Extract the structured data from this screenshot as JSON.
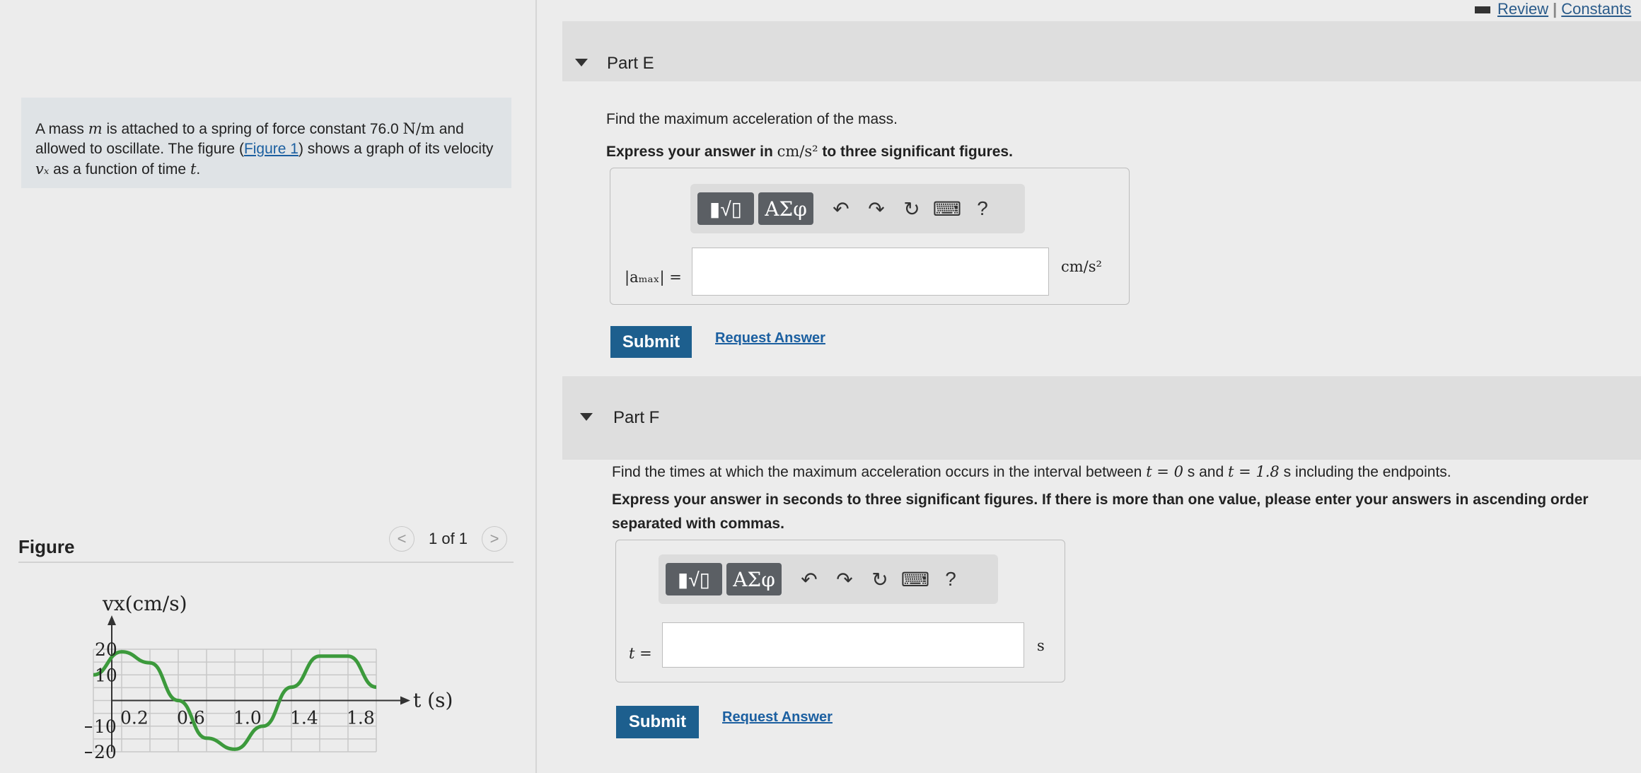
{
  "topbar": {
    "review": "Review",
    "constants": "Constants",
    "separator": "|"
  },
  "intro": {
    "p1": "A mass ",
    "m": "m",
    "p2": " is attached to a spring of force constant 76.0 ",
    "unit": "N/m",
    "p3": " and allowed to oscillate. The figure (",
    "link": "Figure 1",
    "p4": ") shows a graph of its velocity ",
    "vx": "vₓ",
    "p5": " as a function of time ",
    "t": "t",
    "p6": "."
  },
  "figure": {
    "title": "Figure",
    "pager": "1 of 1",
    "prev": "<",
    "next": ">",
    "chart_data": {
      "type": "line",
      "ylabel": "vx(cm/s)",
      "xlabel": "t (s)",
      "xticks": [
        "0.2",
        "0.6",
        "1.0",
        "1.4",
        "1.8"
      ],
      "yticks": [
        "20",
        "10",
        "−10",
        "−20"
      ],
      "xlim": [
        0,
        2.0
      ],
      "ylim": [
        -20,
        20
      ],
      "series": [
        {
          "x": [
            0,
            0.2,
            0.4,
            0.6,
            0.8,
            1.0,
            1.2,
            1.4,
            1.6,
            1.8,
            2.0
          ],
          "values": [
            10,
            19.0,
            14.7,
            0,
            -14.7,
            -19.0,
            -10,
            5.2,
            17.3,
            17.3,
            5.2
          ]
        }
      ]
    }
  },
  "partE": {
    "label": "Part E",
    "question": "Find the maximum acceleration of the mass.",
    "instr1": "Express your answer in ",
    "instr_unit": "cm/s²",
    "instr2": " to three significant figures.",
    "toolbar": {
      "template_label": "▮√▯",
      "greek_label": "ΑΣφ",
      "undo": "↶",
      "redo": "↷",
      "reset": "↻",
      "keyboard": "⌨",
      "help": "?"
    },
    "var_label": "|aₘₐₓ| =",
    "unit": "cm/s²",
    "input_value": "",
    "submit": "Submit",
    "request": "Request Answer"
  },
  "partF": {
    "label": "Part F",
    "question1": "Find the times at which the maximum acceleration occurs in the interval between ",
    "q_t0": "t = 0",
    "q_s1": " s and ",
    "q_t1": "t = 1.8",
    "q_s2": " s including the endpoints.",
    "instr": "Express your answer in seconds to three significant figures. If there is more than one value, please enter your answers in ascending order separated with commas.",
    "toolbar": {
      "template_label": "▮√▯",
      "greek_label": "ΑΣφ",
      "undo": "↶",
      "redo": "↷",
      "reset": "↻",
      "keyboard": "⌨",
      "help": "?"
    },
    "var_label": "t =",
    "unit": "s",
    "input_value": "",
    "submit": "Submit",
    "request": "Request Answer"
  },
  "colors": {
    "accent": "#1d5f8e",
    "curve": "#3c9a3c",
    "link": "#1b5fa0"
  }
}
